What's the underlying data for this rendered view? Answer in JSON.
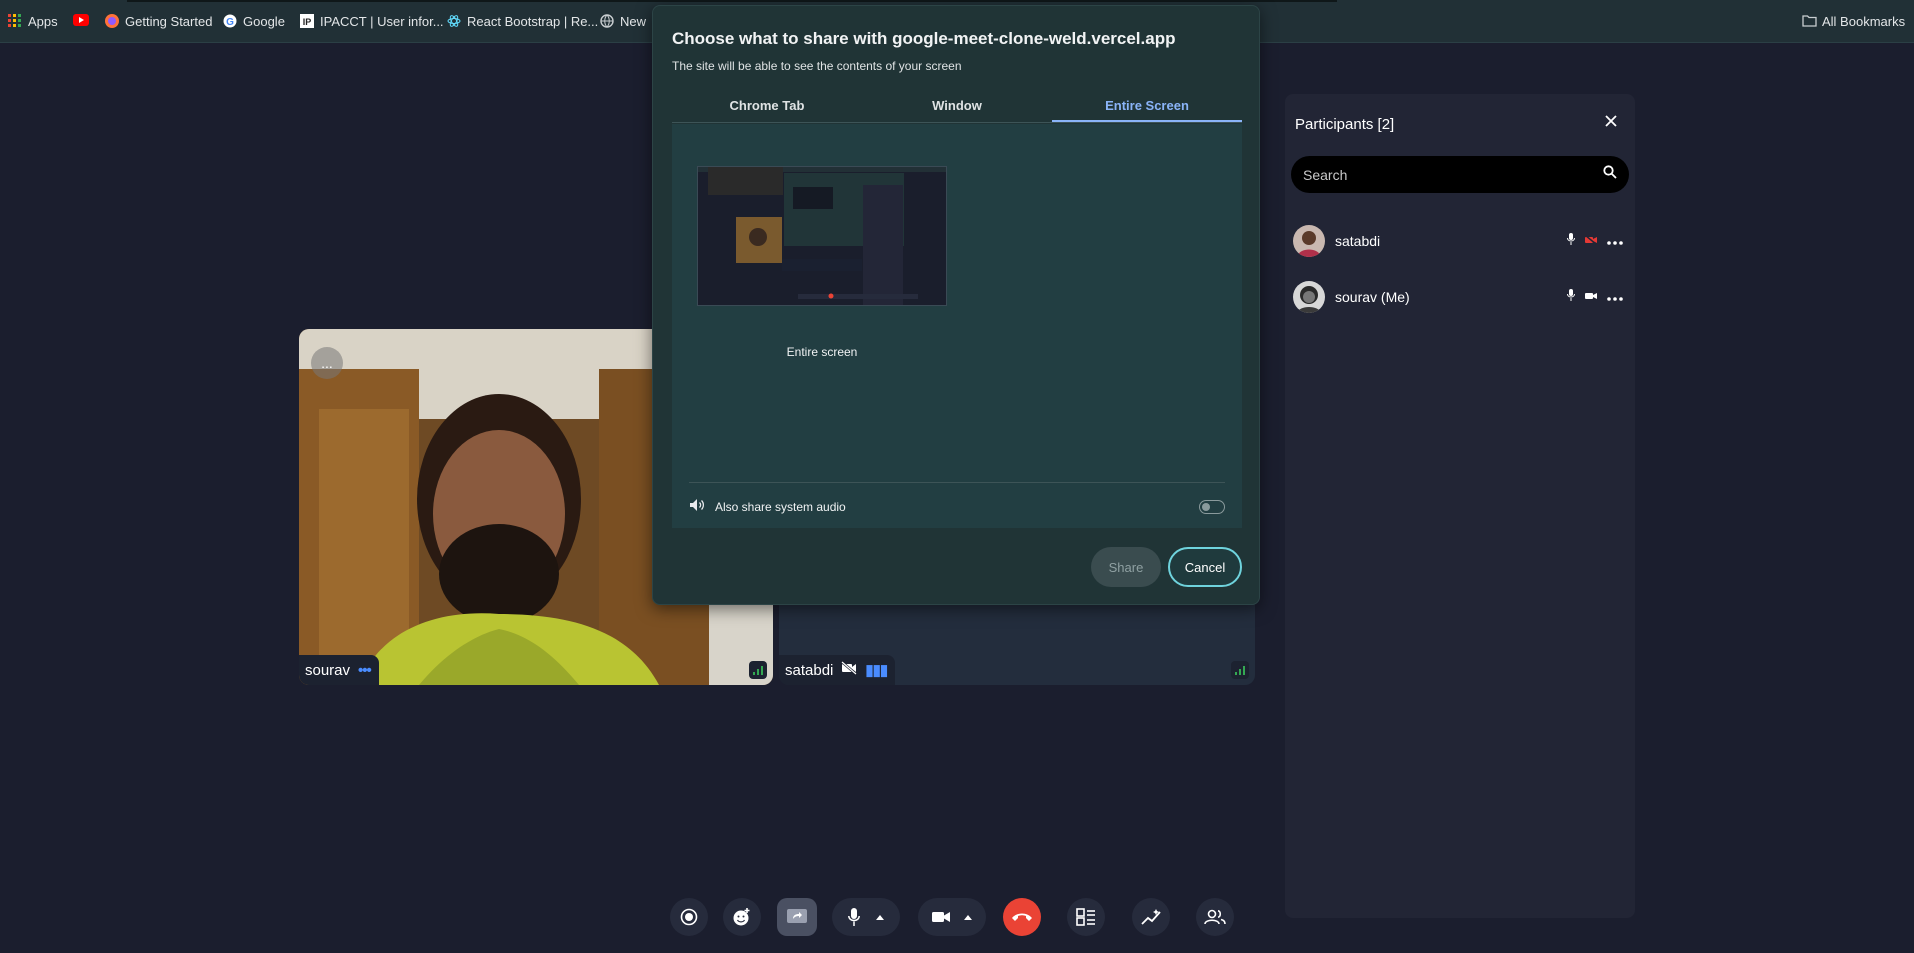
{
  "bookmarks": {
    "items": [
      {
        "label": "Apps",
        "icon": "apps-grid-icon"
      },
      {
        "label": "",
        "icon": "youtube-icon"
      },
      {
        "label": "Getting Started",
        "icon": "firefox-icon"
      },
      {
        "label": "Google",
        "icon": "google-icon"
      },
      {
        "label": "IPACCT | User infor...",
        "icon": "ip-icon"
      },
      {
        "label": "React Bootstrap | Re...",
        "icon": "react-bootstrap-icon"
      },
      {
        "label": "New",
        "icon": "globe-icon"
      }
    ],
    "all_bookmarks": "All Bookmarks"
  },
  "dialog": {
    "title": "Choose what to share with google-meet-clone-weld.vercel.app",
    "subtitle": "The site will be able to see the contents of your screen",
    "tabs": [
      "Chrome Tab",
      "Window",
      "Entire Screen"
    ],
    "active_tab": "Entire Screen",
    "source_label": "Entire screen",
    "audio_label": "Also share system audio",
    "share": "Share",
    "cancel": "Cancel"
  },
  "tiles": {
    "sourav": {
      "name": "sourav",
      "menu": "..."
    },
    "satabdi": {
      "name": "satabdi"
    }
  },
  "panel": {
    "title": "Participants [2]",
    "search_placeholder": "Search",
    "participants": [
      {
        "name": "satabdi"
      },
      {
        "name": "sourav (Me)"
      }
    ]
  },
  "colors": {
    "accent": "#8ab4f8",
    "end_call": "#ea4335",
    "cancel_border": "#6fd3dd",
    "status_blue": "#4a8cff",
    "cam_off_red": "#e53935"
  }
}
